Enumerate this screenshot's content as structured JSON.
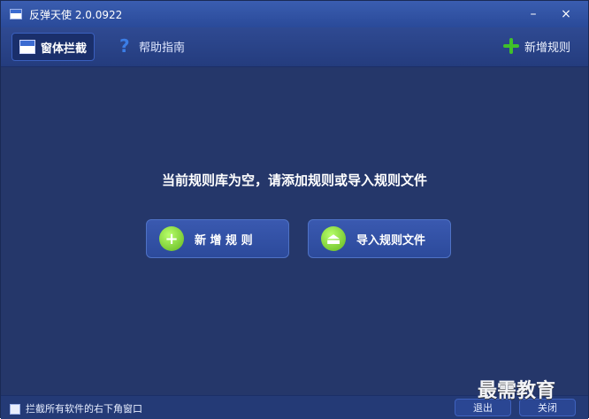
{
  "window": {
    "title": "反弹天使 2.0.0922"
  },
  "toolbar": {
    "tab_window_block": "窗体拦截",
    "tab_help": "帮助指南",
    "add_rule": "新增规则"
  },
  "main": {
    "empty_message": "当前规则库为空，请添加规则或导入规则文件",
    "btn_new_rule": "新 增 规 则",
    "btn_import_rule_file": "导入规则文件"
  },
  "footer": {
    "block_checkbox_label": "拦截所有软件的右下角窗口",
    "exit": "退出",
    "close": "关闭"
  },
  "icons": {
    "app": "window-icon",
    "window_block": "block-window-icon",
    "help": "question-icon",
    "add": "plus-icon",
    "import": "eject-icon"
  },
  "brand": {
    "primary": "#25376a",
    "accent": "#40c02a"
  },
  "watermark": "最需教育"
}
